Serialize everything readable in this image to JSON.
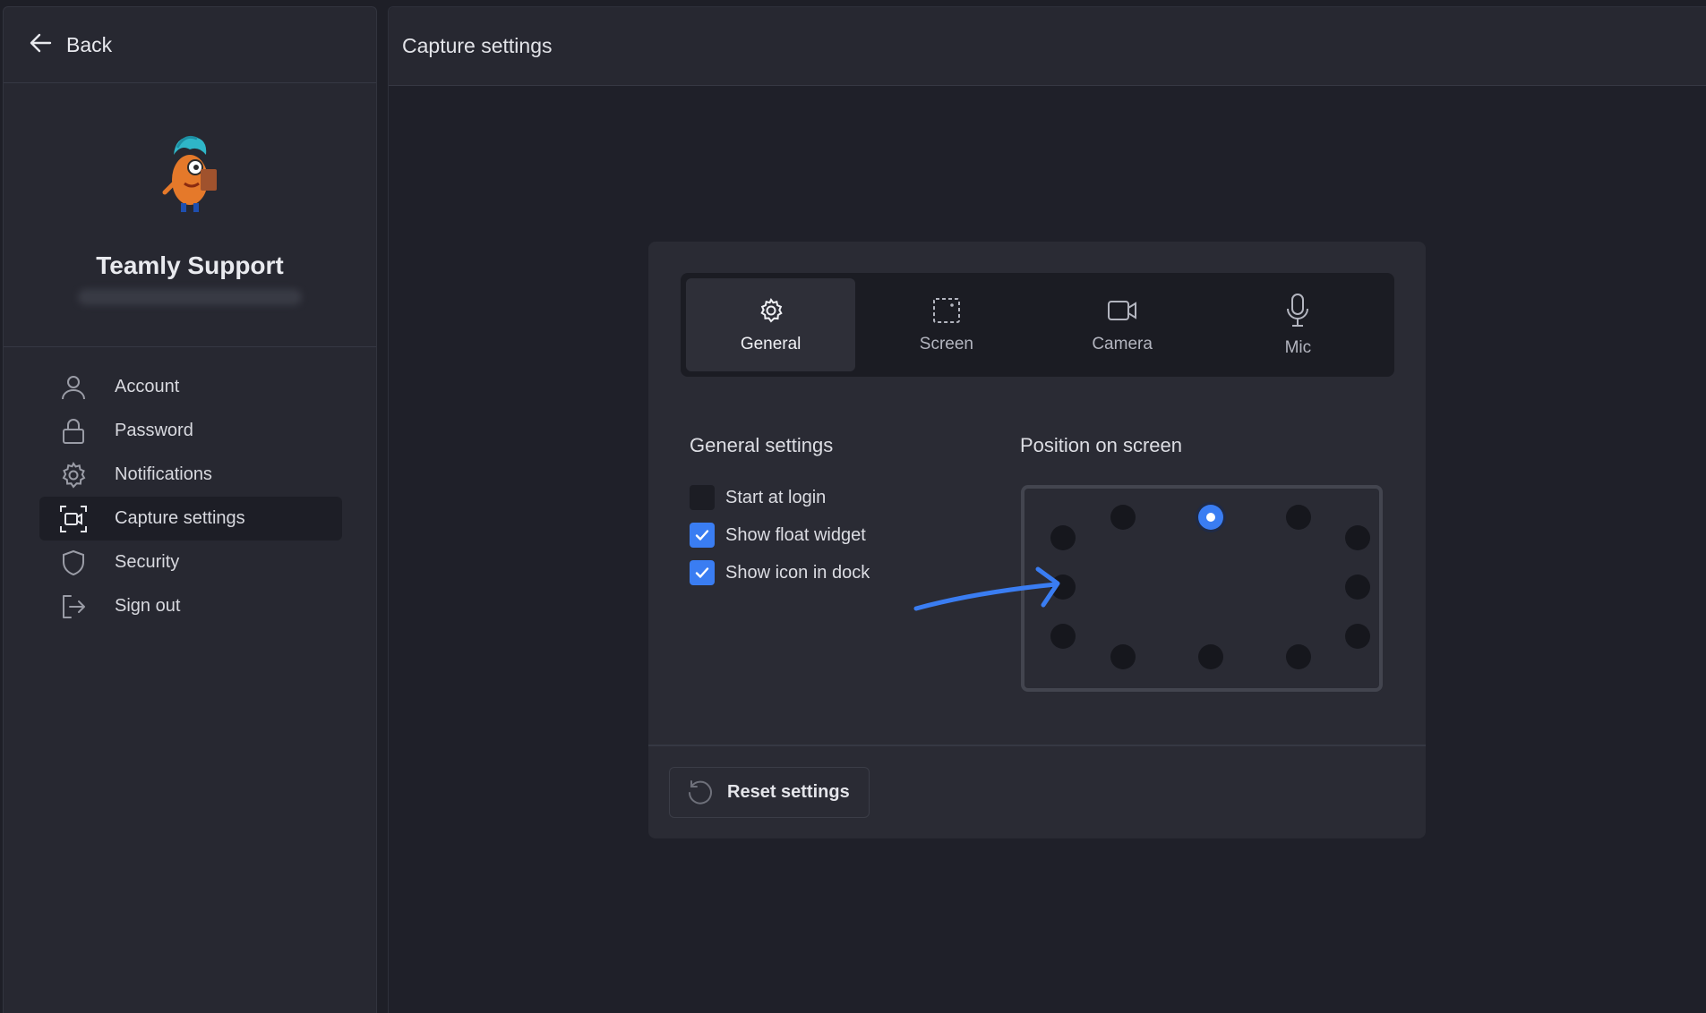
{
  "sidebar": {
    "back_label": "Back",
    "profile_name": "Teamly Support",
    "items": [
      {
        "label": "Account",
        "icon": "user-icon"
      },
      {
        "label": "Password",
        "icon": "lock-icon"
      },
      {
        "label": "Notifications",
        "icon": "gear-icon"
      },
      {
        "label": "Capture settings",
        "icon": "capture-icon",
        "active": true
      },
      {
        "label": "Security",
        "icon": "shield-icon"
      },
      {
        "label": "Sign out",
        "icon": "sign-out-icon"
      }
    ]
  },
  "main": {
    "title": "Capture settings",
    "tabs": [
      {
        "label": "General",
        "icon": "gear-icon",
        "active": true
      },
      {
        "label": "Screen",
        "icon": "screen-select-icon"
      },
      {
        "label": "Camera",
        "icon": "camera-icon"
      },
      {
        "label": "Mic",
        "icon": "mic-icon"
      }
    ],
    "general_settings": {
      "title": "General settings",
      "options": [
        {
          "label": "Start at login",
          "checked": false
        },
        {
          "label": "Show float widget",
          "checked": true
        },
        {
          "label": "Show icon in dock",
          "checked": true
        }
      ]
    },
    "position": {
      "title": "Position on screen",
      "selected": "top-center"
    },
    "reset_label": "Reset settings"
  },
  "colors": {
    "accent": "#3a7df2",
    "background": "#1f2029",
    "panel": "#272831",
    "card": "#2a2b34"
  }
}
